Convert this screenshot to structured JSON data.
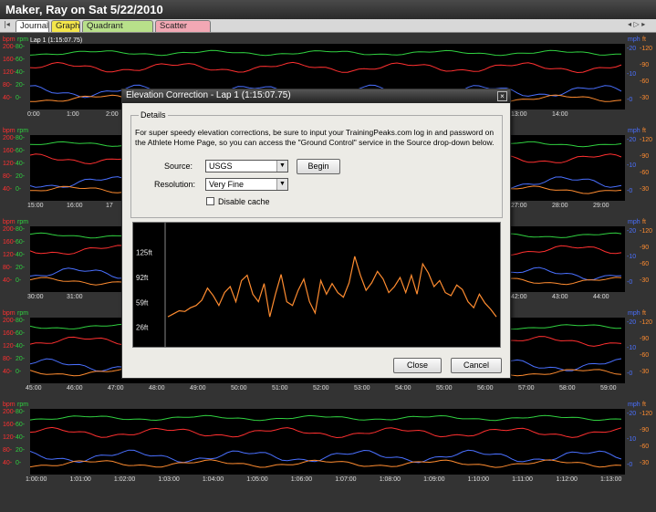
{
  "window": {
    "title": "Maker, Ray on Sat 5/22/2010"
  },
  "tabs": [
    {
      "label": "Journal",
      "color": "#ffffff"
    },
    {
      "label": "Graph",
      "color": "#f4e64a"
    },
    {
      "label": "Quadrant Analysis",
      "color": "#b8e08a"
    },
    {
      "label": "Scatter Graph",
      "color": "#f2a8b4"
    }
  ],
  "nav": {
    "left": "|◂",
    "right": "◂ ▷ ▸"
  },
  "axis_labels": {
    "bpm": "bpm",
    "rpm": "rpm",
    "mph": "mph",
    "ft": "ft"
  },
  "lap_label": "Lap 1 (1:15:07.75)",
  "left_ticks": [
    "200-",
    "80-",
    "160-",
    "60-",
    "120-",
    "40-",
    "80-",
    "20-",
    "40-",
    "0-"
  ],
  "right_ticks_mph": [
    "-20",
    "-10",
    "-0"
  ],
  "right_ticks_ft": [
    "-120",
    "-90",
    "-60",
    "-30"
  ],
  "bands": [
    {
      "x_labels": [
        "0:00",
        "1:00",
        "2:00",
        "13:00",
        "14:00"
      ]
    },
    {
      "x_labels": [
        "15:00",
        "16:00",
        "17",
        "27:00",
        "28:00",
        "29:00"
      ]
    },
    {
      "x_labels": [
        "30:00",
        "31:00",
        "42:00",
        "43:00",
        "44:00"
      ]
    },
    {
      "x_labels": [
        "45:00",
        "46:00",
        "47:00",
        "48:00",
        "49:00",
        "50:00",
        "51:00",
        "52:00",
        "53:00",
        "54:00",
        "55:00",
        "56:00",
        "57:00",
        "58:00",
        "59:00"
      ]
    },
    {
      "x_labels": [
        "1:00:00",
        "1:01:00",
        "1:02:00",
        "1:03:00",
        "1:04:00",
        "1:05:00",
        "1:06:00",
        "1:07:00",
        "1:08:00",
        "1:09:00",
        "1:10:00",
        "1:11:00",
        "1:12:00",
        "1:13:00"
      ]
    }
  ],
  "colors": {
    "hr": "#ff3030",
    "cadence": "#30d040",
    "speed": "#4a70ff",
    "elevation": "#ff8c30"
  },
  "dialog": {
    "title": "Elevation Correction - Lap 1 (1:15:07.75)",
    "close": "×",
    "group": "Details",
    "info": "For super speedy elevation corrections, be sure to input your TrainingPeaks.com log in and password on the Athlete Home Page, so you can access the \"Ground Control\" service in the Source drop-down below.",
    "source_label": "Source:",
    "source_value": "USGS",
    "begin": "Begin",
    "resolution_label": "Resolution:",
    "resolution_value": "Very Fine",
    "disable_cache": "Disable cache",
    "elev_ticks": [
      "125ft",
      "92ft",
      "59ft",
      "26ft"
    ],
    "close_button": "Close",
    "cancel_button": "Cancel"
  },
  "chart_data": {
    "type": "line",
    "title": "",
    "xlabel": "",
    "ylabel": "",
    "y_ticks": [
      "125ft",
      "92ft",
      "59ft",
      "26ft"
    ],
    "ylim": [
      10,
      150
    ],
    "series": [
      {
        "values": [
          40,
          44,
          48,
          47,
          52,
          55,
          62,
          78,
          68,
          55,
          72,
          80,
          60,
          88,
          95,
          70,
          60,
          84,
          40,
          70,
          96,
          60,
          55,
          75,
          90,
          60,
          45,
          88,
          70,
          84,
          72,
          66,
          85,
          120,
          95,
          75,
          85,
          100,
          90,
          72,
          80,
          92,
          72,
          95,
          70,
          110,
          98,
          80,
          88,
          72,
          68,
          82,
          76,
          60,
          52,
          70,
          58,
          50,
          40
        ]
      }
    ]
  }
}
